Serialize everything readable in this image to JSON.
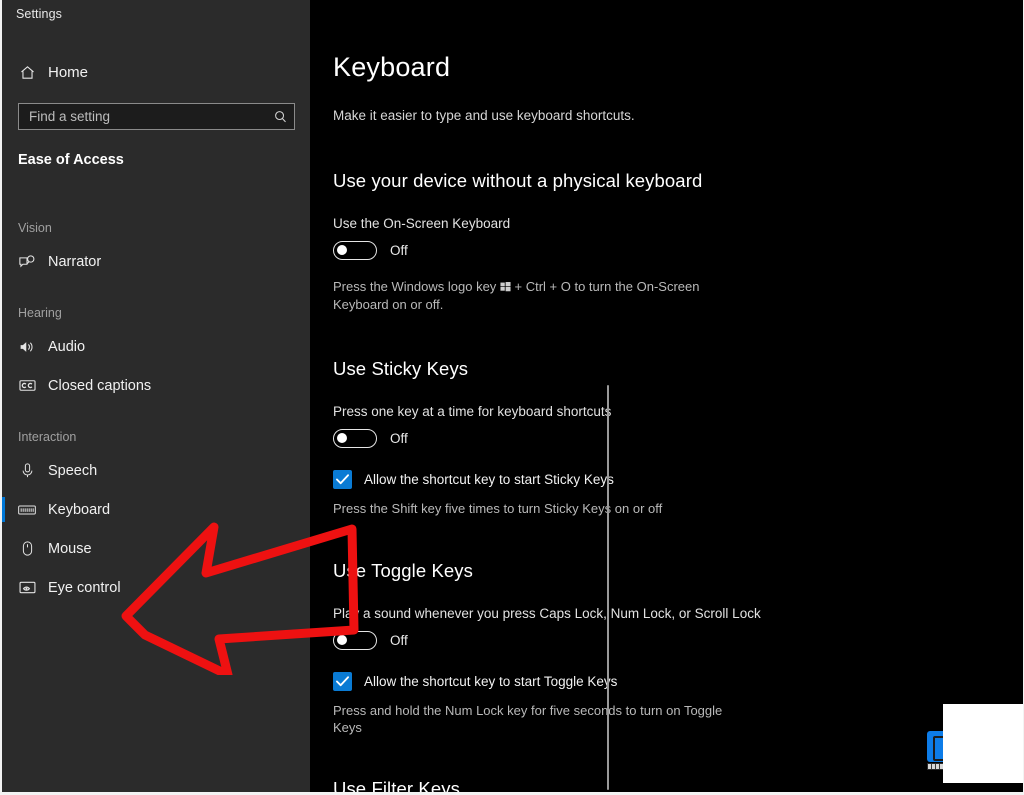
{
  "window": {
    "app_title": "Settings"
  },
  "sidebar": {
    "home_label": "Home",
    "home_icon": "home-icon",
    "search": {
      "placeholder": "Find a setting",
      "value": "",
      "icon": "search-icon"
    },
    "category": "Ease of Access",
    "groups": [
      {
        "title": "Vision",
        "items": [
          {
            "label": "Narrator",
            "icon": "narrator-icon",
            "selected": false
          }
        ]
      },
      {
        "title": "Hearing",
        "items": [
          {
            "label": "Audio",
            "icon": "speaker-icon",
            "selected": false
          },
          {
            "label": "Closed captions",
            "icon": "closed-captions-icon",
            "selected": false
          }
        ]
      },
      {
        "title": "Interaction",
        "items": [
          {
            "label": "Speech",
            "icon": "microphone-icon",
            "selected": false
          },
          {
            "label": "Keyboard",
            "icon": "keyboard-icon",
            "selected": true
          },
          {
            "label": "Mouse",
            "icon": "mouse-icon",
            "selected": false
          },
          {
            "label": "Eye control",
            "icon": "eye-control-icon",
            "selected": false
          }
        ]
      }
    ]
  },
  "main": {
    "title": "Keyboard",
    "subtitle": "Make it easier to type and use keyboard shortcuts.",
    "sections": {
      "onscreen": {
        "heading": "Use your device without a physical keyboard",
        "setting_label": "Use the On-Screen Keyboard",
        "toggle_state": "Off",
        "note_before": "Press the Windows logo key ",
        "note_after": " + Ctrl + O to turn the On-Screen Keyboard on or off."
      },
      "sticky": {
        "heading": "Use Sticky Keys",
        "setting_label": "Press one key at a time for keyboard shortcuts",
        "toggle_state": "Off",
        "checkbox_label": "Allow the shortcut key to start Sticky Keys",
        "checkbox_checked": true,
        "note": "Press the Shift key five times to turn Sticky Keys on or off"
      },
      "toggle": {
        "heading": "Use Toggle Keys",
        "setting_label": "Play a sound whenever you press Caps Lock, Num Lock, or Scroll Lock",
        "toggle_state": "Off",
        "checkbox_label": "Allow the shortcut key to start Toggle Keys",
        "checkbox_checked": true,
        "note": "Press and hold the Num Lock key for five seconds to turn on Toggle Keys"
      },
      "filter": {
        "heading": "Use Filter Keys"
      }
    }
  },
  "annotation": {
    "type": "arrow",
    "direction": "left",
    "color": "#ee1111",
    "points_at": "sidebar-item-keyboard"
  },
  "colors": {
    "accent": "#0078d7",
    "checkbox": "#0a7bd4",
    "sidebar_bg": "#2b2b2b",
    "content_bg": "#000000",
    "annotation_red": "#ee1111"
  }
}
